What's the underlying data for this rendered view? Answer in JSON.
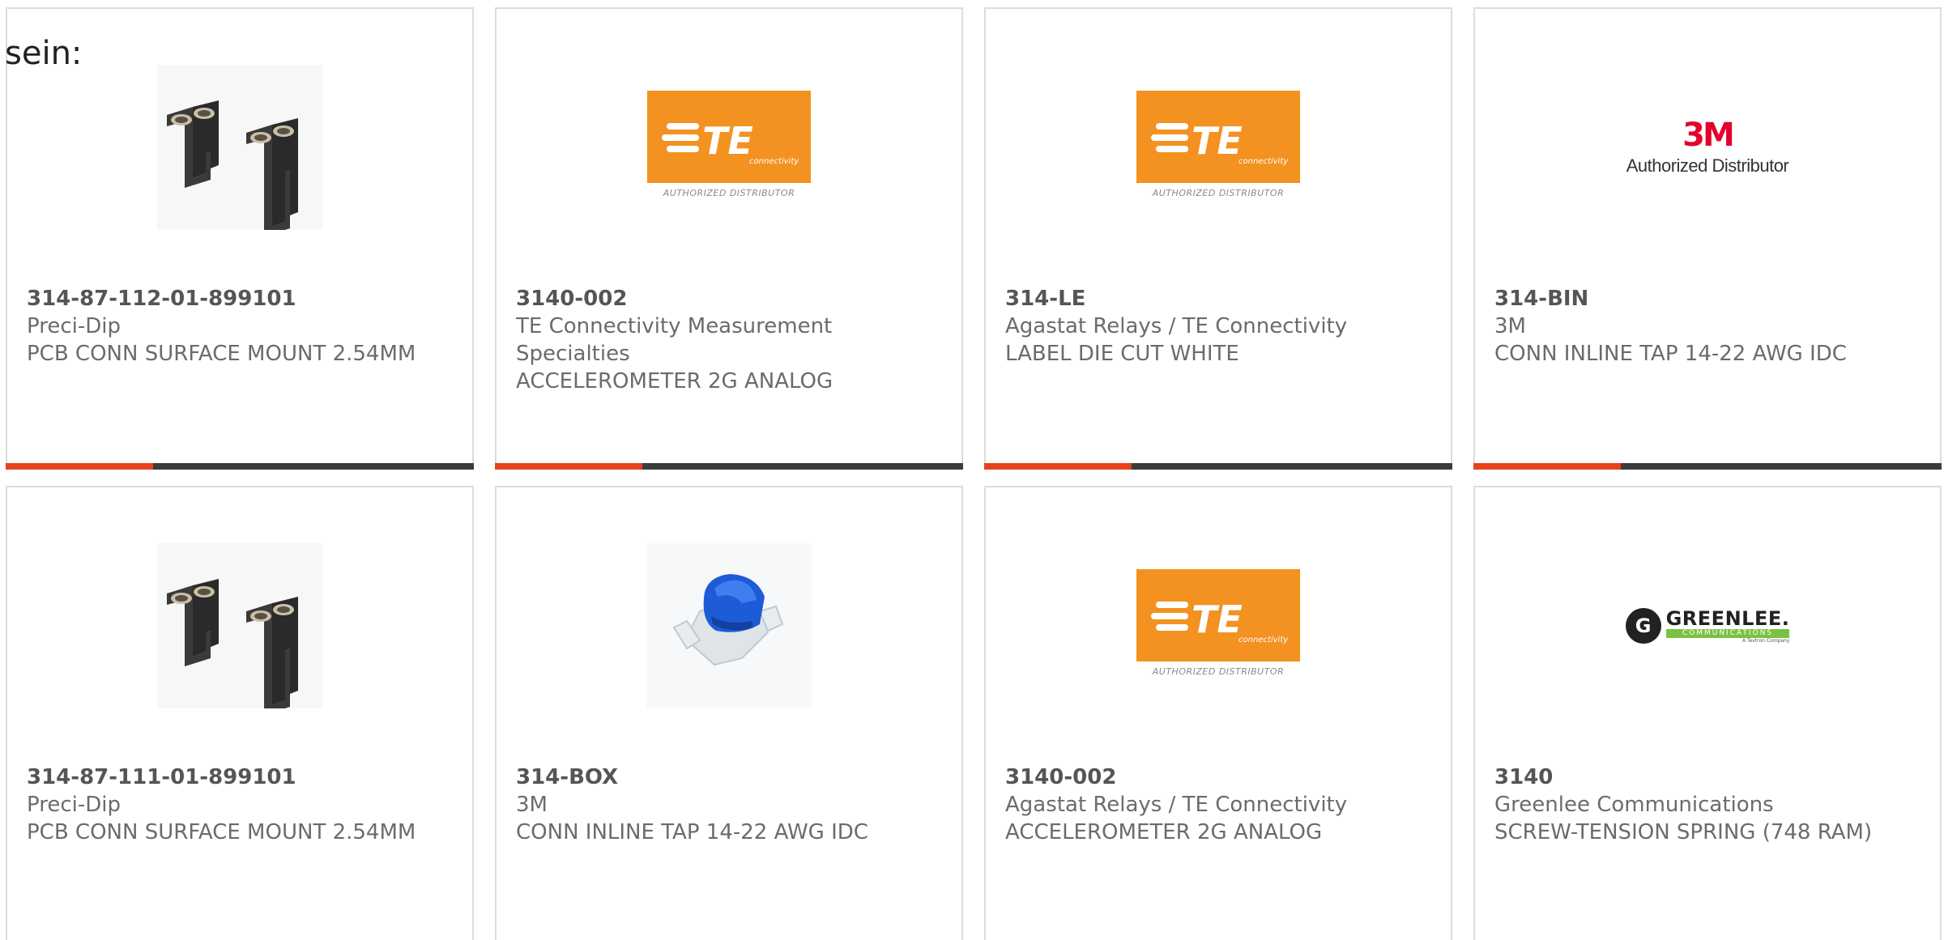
{
  "lead_text": "sein:",
  "colors": {
    "accent": "#e8421d",
    "bar": "#3c3c3c",
    "te_orange": "#f39220",
    "mmm_red": "#e4002b",
    "greenlee_green": "#7ac143"
  },
  "te_logo": {
    "caption": "AUTHORIZED DISTRIBUTOR",
    "wordmark": "TE",
    "tagline": "connectivity"
  },
  "mmm_logo": {
    "mark": "3M",
    "caption": "Authorized Distributor"
  },
  "greenlee_logo": {
    "initial": "G",
    "name": "GREENLEE.",
    "sub": "COMMUNICATIONS",
    "tiny": "A Textron Company"
  },
  "products": [
    {
      "part_number": "314-87-112-01-899101",
      "manufacturer": "Preci-Dip",
      "description": "PCB CONN SURFACE MOUNT 2.54MM",
      "image": "sip-socket-image"
    },
    {
      "part_number": "3140-002",
      "manufacturer": "TE Connectivity Measurement Specialties",
      "description": "ACCELEROMETER 2G ANALOG",
      "image": "te-logo"
    },
    {
      "part_number": "314-LE",
      "manufacturer": "Agastat Relays / TE Connectivity",
      "description": "LABEL DIE CUT WHITE",
      "image": "te-logo"
    },
    {
      "part_number": "314-BIN",
      "manufacturer": "3M",
      "description": "CONN INLINE TAP 14-22 AWG IDC",
      "image": "3m-logo"
    },
    {
      "part_number": "314-87-111-01-899101",
      "manufacturer": "Preci-Dip",
      "description": "PCB CONN SURFACE MOUNT 2.54MM",
      "image": "sip-socket-image"
    },
    {
      "part_number": "314-BOX",
      "manufacturer": "3M",
      "description": "CONN INLINE TAP 14-22 AWG IDC",
      "image": "tap-connector-image"
    },
    {
      "part_number": "3140-002",
      "manufacturer": "Agastat Relays / TE Connectivity",
      "description": "ACCELEROMETER 2G ANALOG",
      "image": "te-logo"
    },
    {
      "part_number": "3140",
      "manufacturer": "Greenlee Communications",
      "description": "SCREW-TENSION SPRING (748 RAM)",
      "image": "greenlee-logo"
    }
  ]
}
